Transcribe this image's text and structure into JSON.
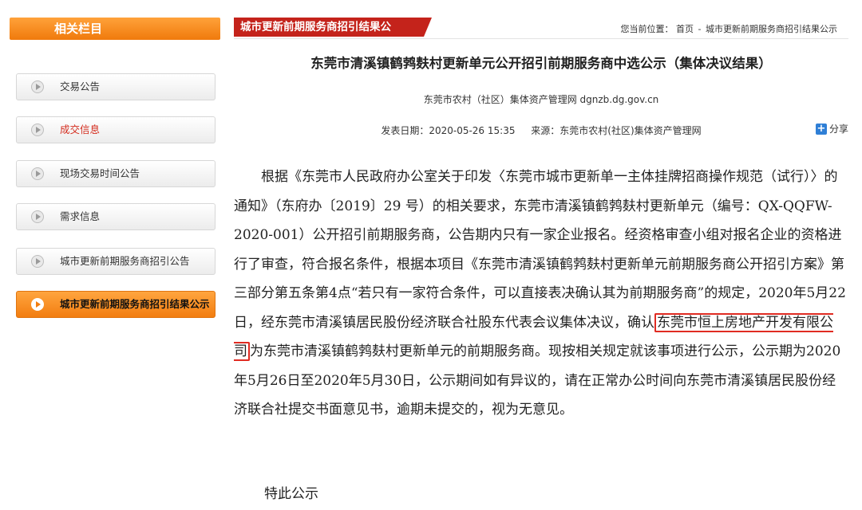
{
  "sidebar": {
    "header": "相关栏目",
    "items": [
      {
        "label": "交易公告"
      },
      {
        "label": "成交信息"
      },
      {
        "label": "现场交易时间公告"
      },
      {
        "label": "需求信息"
      },
      {
        "label": "城市更新前期服务商招引公告"
      },
      {
        "label": "城市更新前期服务商招引结果公示"
      }
    ],
    "active_index": 5,
    "accent_color": "#f07a0c"
  },
  "header": {
    "section_tab": "城市更新前期服务商招引结果公",
    "breadcrumb_prefix": "您当前位置：",
    "breadcrumb_home": "首页",
    "breadcrumb_sep": "-",
    "breadcrumb_current": "城市更新前期服务商招引结果公示",
    "tab_color": "#c4231b"
  },
  "article": {
    "title": "东莞市清溪镇鹤鹁麸村更新单元公开招引前期服务商中选公示（集体决议结果）",
    "source_line": "东莞市农村（社区）集体资产管理网   dgnzb.dg.gov.cn",
    "publish_date": "发表日期：2020-05-26 15:35",
    "source": "来源：东莞市农村(社区)集体资产管理网",
    "share_label": "分享",
    "body_before": "根据《东莞市人民政府办公室关于印发〈东莞市城市更新单一主体挂牌招商操作规范（试行）〉的通知》（东府办〔2019〕29 号）的相关要求，东莞市清溪镇鹤鹁麸村更新单元（编号：QX-QQFW-2020-001）公开招引前期服务商，公告期内只有一家企业报名。经资格审查小组对报名企业的资格进行了审查，符合报名条件，根据本项目《东莞市清溪镇鹤鹁麸村更新单元前期服务商公开招引方案》第三部分第五条第4点“若只有一家符合条件，可以直接表决确认其为前期服务商”的规定，2020年5月22日，经东莞市清溪镇居民股份经济联合社股东代表会议集体决议，确认",
    "highlighted_company": "东莞市恒上房地产开发有限公司",
    "body_after": "为东莞市清溪镇鹤鹁麸村更新单元的前期服务商。现按相关规定就该事项进行公示，公示期为2020年5月26日至2020年5月30日，公示期间如有异议的，请在正常办公时间向东莞市清溪镇居民股份经济联合社提交书面意见书，逾期未提交的，视为无意见。",
    "closing": "特此公示",
    "highlight_color": "#e02b22"
  }
}
